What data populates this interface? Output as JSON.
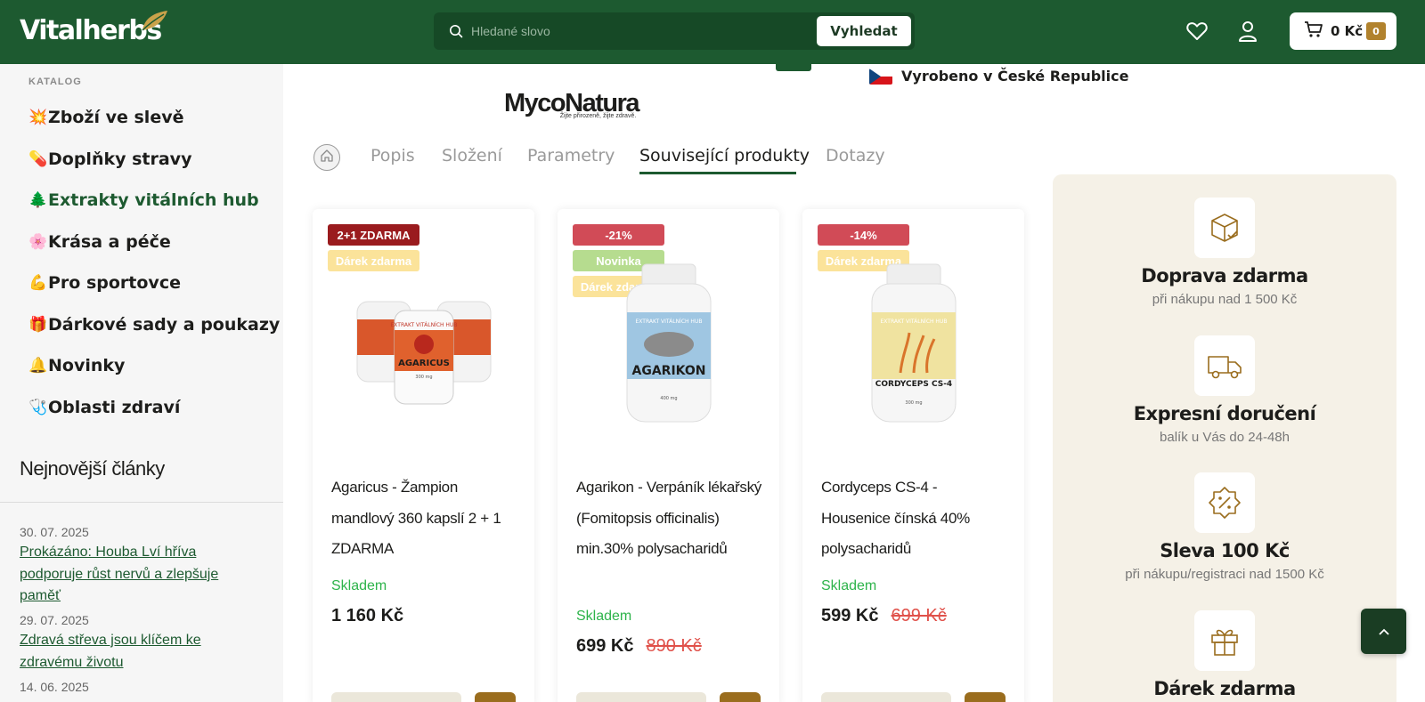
{
  "header": {
    "logo_text": "Vitalherbs",
    "search_placeholder": "Hledané slovo",
    "search_button": "Vyhledat",
    "cart_total": "0 Kč",
    "cart_count": "0",
    "colors": {
      "header_bg": "#1d5a30",
      "accent": "#b1822d"
    }
  },
  "sidebar": {
    "catalog_label": "KATALOG",
    "categories": [
      {
        "emoji": "💥",
        "label": "Zboží ve slevě"
      },
      {
        "emoji": "💊",
        "label": "Doplňky stravy"
      },
      {
        "emoji": "🌲",
        "label": "Extrakty vitálních hub"
      },
      {
        "emoji": "🌸",
        "label": "Krása a péče"
      },
      {
        "emoji": "💪",
        "label": "Pro sportovce"
      },
      {
        "emoji": "🎁",
        "label": "Dárkové sady a poukazy"
      },
      {
        "emoji": "🔔",
        "label": "Novinky"
      },
      {
        "emoji": "🩺",
        "label": "Oblasti zdraví"
      }
    ],
    "articles_title": "Nejnovější články",
    "articles": [
      {
        "date": "30. 07. 2025",
        "title": "Prokázáno: Houba Lví hříva podporuje růst nervů a zlepšuje paměť"
      },
      {
        "date": "29. 07. 2025",
        "title": "Zdravá střeva jsou klíčem ke zdravému životu"
      },
      {
        "date": "14. 06. 2025",
        "title": ""
      }
    ]
  },
  "main": {
    "made_in": "Vyrobeno v České Republice",
    "brand_name": "MycoNatura",
    "brand_tagline": "Žijte přirozeně, žijte zdravě.",
    "tabs": [
      "Popis",
      "Složení",
      "Parametry",
      "Související produkty",
      "Dotazy"
    ],
    "active_tab": "Související produkty",
    "products": [
      {
        "badges": [
          "2+1 ZDARMA",
          "Dárek zdarma"
        ],
        "name": "Agaricus - Žampion mandlový 360 kapslí 2 + 1 ZDARMA",
        "stock": "Skladem",
        "price": "1 160 Kč",
        "old_price": ""
      },
      {
        "badges": [
          "-21%",
          "Novinka",
          "Dárek zdarma"
        ],
        "name": "Agarikon - Verpáník lékařský (Fomitopsis officinalis) min.30% polysacharidů",
        "stock": "Skladem",
        "price": "699 Kč",
        "old_price": "890 Kč"
      },
      {
        "badges": [
          "-14%",
          "Dárek zdarma"
        ],
        "name": "Cordyceps CS-4 - Housenice čínská 40% polysacharidů",
        "stock": "Skladem",
        "price": "599 Kč",
        "old_price": "699 Kč"
      }
    ],
    "product_labels": [
      {
        "brand": "EXTRAKT VITÁLNÍCH HUB",
        "name": "AGARICUS",
        "dose": "300 mg"
      },
      {
        "brand": "EXTRAKT VITÁLNÍCH HUB",
        "name": "AGARIKON",
        "dose": "400 mg"
      },
      {
        "brand": "EXTRAKT VITÁLNÍCH HUB",
        "name": "CORDYCEPS CS-4",
        "dose": "300 mg"
      }
    ],
    "benefits": [
      {
        "icon": "package-check-icon",
        "title": "Doprava zdarma",
        "subtitle": "při nákupu nad 1 500 Kč"
      },
      {
        "icon": "truck-icon",
        "title": "Expresní doručení",
        "subtitle": "balík u Vás do 24-48h"
      },
      {
        "icon": "discount-icon",
        "title": "Sleva 100 Kč",
        "subtitle": "při nákupu/registraci nad 1500 Kč"
      },
      {
        "icon": "gift-icon",
        "title": "Dárek zdarma",
        "subtitle": ""
      }
    ]
  }
}
